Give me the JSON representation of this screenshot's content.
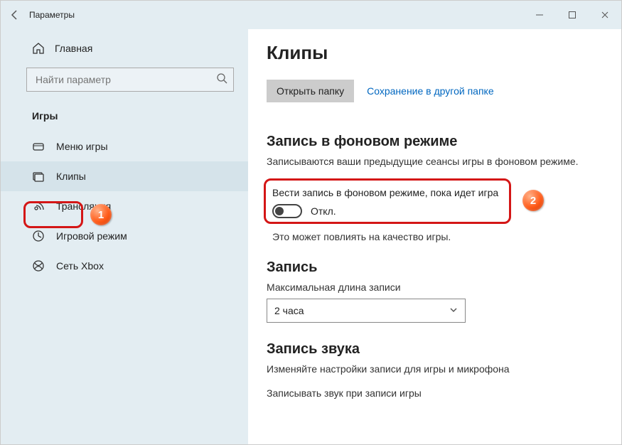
{
  "titlebar": {
    "title": "Параметры"
  },
  "sidebar": {
    "home_label": "Главная",
    "search_placeholder": "Найти параметр",
    "section": "Игры",
    "items": [
      {
        "label": "Меню игры"
      },
      {
        "label": "Клипы"
      },
      {
        "label": "Трансляция"
      },
      {
        "label": "Игровой режим"
      },
      {
        "label": "Сеть Xbox"
      }
    ]
  },
  "content": {
    "heading": "Клипы",
    "open_folder_btn": "Открыть папку",
    "save_link": "Сохранение в другой папке",
    "bg_heading": "Запись в фоновом режиме",
    "bg_desc": "Записываются ваши предыдущие сеансы игры в фоновом режиме.",
    "toggle_label": "Вести запись в фоновом режиме, пока идет игра",
    "toggle_state": "Откл.",
    "bg_note": "Это может повлиять на качество игры.",
    "rec_heading": "Запись",
    "rec_label": "Максимальная длина записи",
    "rec_value": "2 часа",
    "audio_heading": "Запись звука",
    "audio_desc": "Изменяйте настройки записи для игры и микрофона",
    "audio_toggle_label": "Записывать звук при записи игры"
  },
  "annotations": {
    "badge1": "1",
    "badge2": "2"
  }
}
